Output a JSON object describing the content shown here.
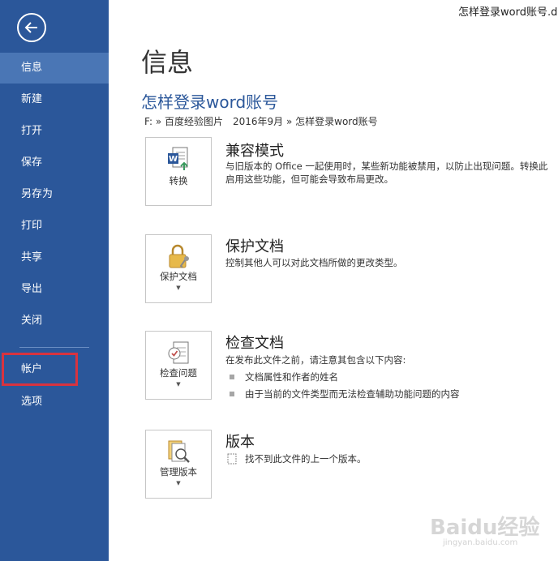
{
  "window": {
    "doc_filename": "怎样登录word账号.doc"
  },
  "sidebar": {
    "items": [
      {
        "label": "信息"
      },
      {
        "label": "新建"
      },
      {
        "label": "打开"
      },
      {
        "label": "保存"
      },
      {
        "label": "另存为"
      },
      {
        "label": "打印"
      },
      {
        "label": "共享"
      },
      {
        "label": "导出"
      },
      {
        "label": "关闭"
      },
      {
        "label": "帐户"
      },
      {
        "label": "选项"
      }
    ]
  },
  "main": {
    "title": "信息",
    "doc_title": "怎样登录word账号",
    "path": "F: » 百度经验图片　2016年9月 » 怎样登录word账号",
    "sections": {
      "compat": {
        "tile_label": "转换",
        "title": "兼容模式",
        "line1": "与旧版本的 Office 一起使用时，某些新功能被禁用，以防止出现问题。转换此",
        "line2": "启用这些功能，但可能会导致布局更改。"
      },
      "protect": {
        "tile_label": "保护文档",
        "title": "保护文档",
        "line1": "控制其他人可以对此文档所做的更改类型。"
      },
      "inspect": {
        "tile_label": "检查问题",
        "title": "检查文档",
        "line1": "在发布此文件之前，请注意其包含以下内容:",
        "bullets": [
          "文档属性和作者的姓名",
          "由于当前的文件类型而无法检查辅助功能问题的内容"
        ]
      },
      "versions": {
        "tile_label": "管理版本",
        "title": "版本",
        "line1": "找不到此文件的上一个版本。"
      }
    }
  },
  "watermark": {
    "brand": "Baidu经验",
    "url": "jingyan.baidu.com"
  },
  "colors": {
    "sidebar": "#2b579a",
    "sidebar_active": "#4a76b5",
    "highlight": "#d8333f",
    "accent_text": "#2b579a"
  }
}
